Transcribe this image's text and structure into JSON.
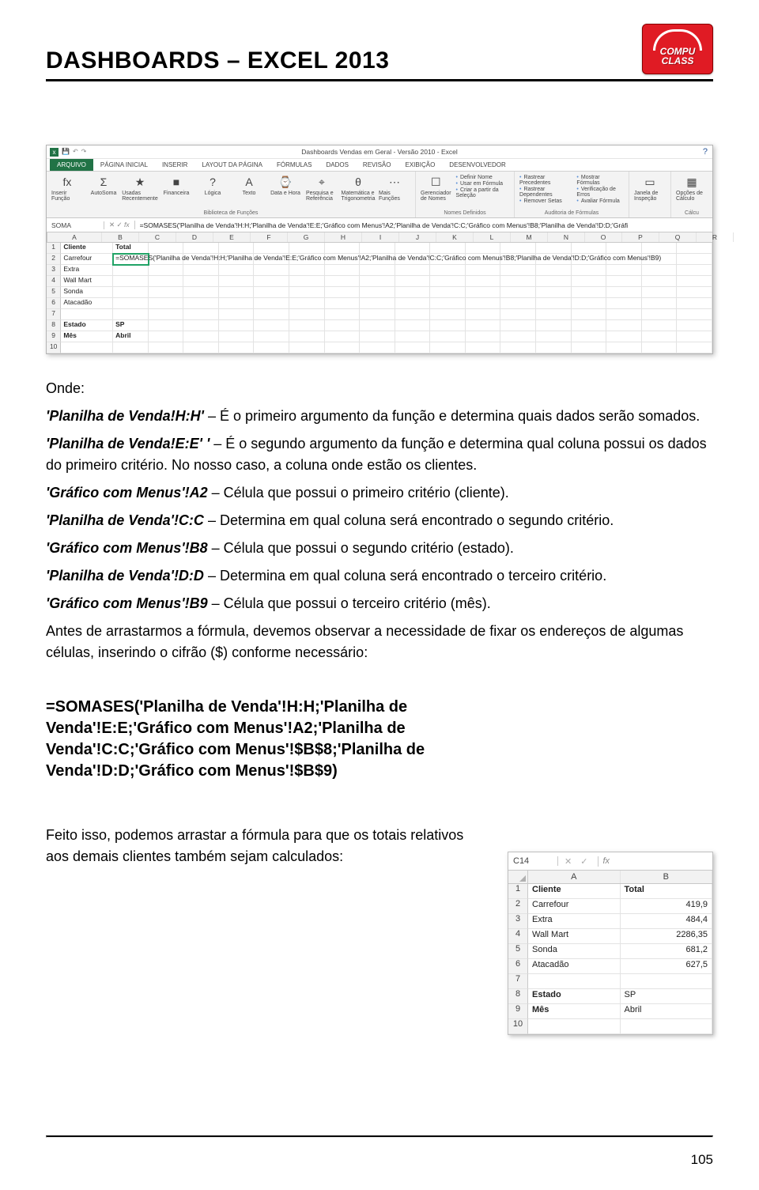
{
  "header": {
    "title": "DASHBOARDS – EXCEL 2013",
    "logo_line1": "COMPU",
    "logo_line2": "CLASS"
  },
  "excel_main": {
    "window_title": "Dashboards Vendas em Geral - Versão 2010 - Excel",
    "tabs": [
      "ARQUIVO",
      "PÁGINA INICIAL",
      "INSERIR",
      "LAYOUT DA PÁGINA",
      "FÓRMULAS",
      "DADOS",
      "REVISÃO",
      "EXIBIÇÃO",
      "DESENVOLVEDOR"
    ],
    "ribbon": {
      "group1": {
        "btns": [
          {
            "icon": "fx",
            "label": "Inserir Função"
          },
          {
            "icon": "Σ",
            "label": "AutoSoma"
          },
          {
            "icon": "★",
            "label": "Usadas Recentemente"
          },
          {
            "icon": "■",
            "label": "Financeira"
          },
          {
            "icon": "?",
            "label": "Lógica"
          },
          {
            "icon": "A",
            "label": "Texto"
          },
          {
            "icon": "⌚",
            "label": "Data e Hora"
          },
          {
            "icon": "⌖",
            "label": "Pesquisa e Referência"
          },
          {
            "icon": "θ",
            "label": "Matemática e Trigonometria"
          },
          {
            "icon": "⋯",
            "label": "Mais Funções"
          }
        ],
        "caption": "Biblioteca de Funções"
      },
      "group2": {
        "btn": {
          "icon": "☐",
          "label": "Gerenciador de Nomes"
        },
        "items": [
          "Definir Nome",
          "Usar em Fórmula",
          "Criar a partir da Seleção"
        ],
        "caption": "Nomes Definidos"
      },
      "group3": {
        "colA": [
          "Rastrear Precedentes",
          "Rastrear Dependentes",
          "Remover Setas"
        ],
        "colB": [
          "Mostrar Fórmulas",
          "Verificação de Erros",
          "Avaliar Fórmula"
        ],
        "caption": "Auditoria de Fórmulas"
      },
      "group4": {
        "btn": {
          "icon": "▭",
          "label": "Janela de Inspeção"
        }
      },
      "group5": {
        "btn": {
          "icon": "▦",
          "label": "Opções de Cálculo"
        },
        "caption": "Cálcu"
      }
    },
    "name_box": "SOMA",
    "formula": "=SOMASES('Planilha de Venda'!H:H;'Planilha de Venda'!E:E;'Gráfico com Menus'!A2;'Planilha de Venda'!C:C;'Gráfico com Menus'!B8;'Planilha de Venda'!D:D;'Gráfi",
    "columns": [
      "A",
      "B",
      "C",
      "D",
      "E",
      "F",
      "G",
      "H",
      "I",
      "J",
      "K",
      "L",
      "M",
      "N",
      "O",
      "P",
      "Q",
      "R"
    ],
    "rows": [
      {
        "n": "1",
        "A": "Cliente",
        "B": "Total",
        "bold": true
      },
      {
        "n": "2",
        "A": "Carrefour",
        "B": "=SOMASES('Planilha de Venda'!H:H;'Planilha de Venda'!E:E;'Gráfico com Menus'!A2;'Planilha de Venda'!C:C;'Gráfico com Menus'!B8;'Planilha de Venda'!D:D;'Gráfico com Menus'!B9)",
        "editing": true
      },
      {
        "n": "3",
        "A": "Extra"
      },
      {
        "n": "4",
        "A": "Wall Mart"
      },
      {
        "n": "5",
        "A": "Sonda"
      },
      {
        "n": "6",
        "A": "Atacadão"
      },
      {
        "n": "7",
        "A": ""
      },
      {
        "n": "8",
        "A": "Estado",
        "B": "SP",
        "bold": true
      },
      {
        "n": "9",
        "A": "Mês",
        "B": "Abril",
        "bold": true
      },
      {
        "n": "10",
        "A": ""
      }
    ]
  },
  "content": {
    "onde_label": "Onde:",
    "p1_ref": "'Planilha de Venda!H:H'",
    "p1_txt": " – É o primeiro argumento da função e determina quais dados serão somados.",
    "p2_ref": "'Planilha de Venda!E:E' '",
    "p2_txt": " – É o segundo argumento da função e determina qual coluna possui os dados do primeiro critério. No nosso caso, a coluna onde estão os clientes.",
    "p3_ref": "'Gráfico com Menus'!A2",
    "p3_txt": " – Célula que possui o primeiro critério (cliente).",
    "p4_ref": "'Planilha de Venda'!C:C",
    "p4_txt": " – Determina em qual coluna será encontrado o segundo critério.",
    "p5_ref": "'Gráfico com Menus'!B8",
    "p5_txt": " – Célula que possui o segundo critério (estado).",
    "p6_ref": "'Planilha de Venda'!D:D",
    "p6_txt": " – Determina em qual coluna será encontrado o terceiro critério.",
    "p7_ref": "'Gráfico com Menus'!B9",
    "p7_txt": " – Célula que possui o terceiro critério (mês).",
    "p8": "Antes de arrastarmos a fórmula, devemos observar a necessidade de fixar os endereços de algumas células, inserindo o cifrão ($) conforme necessário:",
    "formula_block": "=SOMASES('Planilha de Venda'!H:H;'Planilha de Venda'!E:E;'Gráfico com Menus'!A2;'Planilha de Venda'!C:C;'Gráfico com Menus'!$B$8;'Planilha de Venda'!D:D;'Gráfico com Menus'!$B$9)",
    "p9": "Feito isso, podemos arrastar a fórmula para que os totais relativos aos demais clientes também sejam calculados:"
  },
  "excel_small": {
    "name_box": "C14",
    "fx_label": "fx",
    "col_a": "A",
    "col_b": "B",
    "rows": [
      {
        "n": "1",
        "a": "Cliente",
        "b": "Total",
        "bold": true
      },
      {
        "n": "2",
        "a": "Carrefour",
        "b": "419,9"
      },
      {
        "n": "3",
        "a": "Extra",
        "b": "484,4"
      },
      {
        "n": "4",
        "a": "Wall Mart",
        "b": "2286,35"
      },
      {
        "n": "5",
        "a": "Sonda",
        "b": "681,2"
      },
      {
        "n": "6",
        "a": "Atacadão",
        "b": "627,5"
      },
      {
        "n": "7",
        "a": "",
        "b": ""
      },
      {
        "n": "8",
        "a": "Estado",
        "b": "SP",
        "bold": true,
        "left": true
      },
      {
        "n": "9",
        "a": "Mês",
        "b": "Abril",
        "bold": true,
        "left": true
      },
      {
        "n": "10",
        "a": "",
        "b": ""
      }
    ]
  },
  "page_number": "105"
}
